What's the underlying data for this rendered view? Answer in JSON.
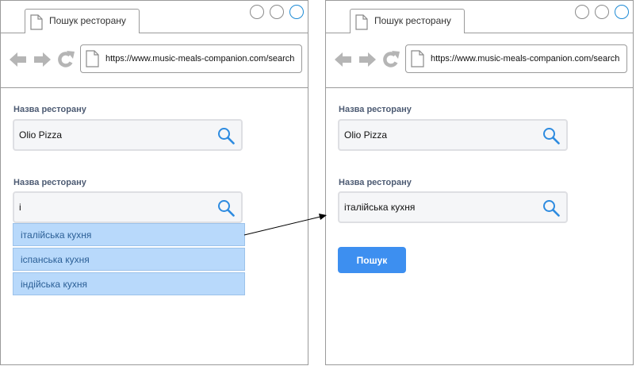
{
  "screens": {
    "left": {
      "tab_title": "Пошук ресторану",
      "url": "https://www.music-meals-companion.com/search",
      "field1": {
        "label": "Назва ресторану",
        "value": "Olio Pizza"
      },
      "field2": {
        "label": "Назва ресторану",
        "value": "і"
      },
      "suggestions": [
        "італійська кухня",
        "іспанська кухня",
        "індійська кухня"
      ]
    },
    "right": {
      "tab_title": "Пошук ресторану",
      "url": "https://www.music-meals-companion.com/search",
      "field1": {
        "label": "Назва ресторану",
        "value": "Olio Pizza"
      },
      "field2": {
        "label": "Назва ресторану",
        "value": "італійська кухня"
      },
      "search_button": "Пошук"
    }
  },
  "colors": {
    "accent": "#3d8ff0",
    "suggestion_bg": "#b8d9fb",
    "label": "#4d5b73"
  },
  "icons": [
    "page-icon",
    "back-arrow-icon",
    "forward-arrow-icon",
    "reload-icon",
    "search-icon"
  ]
}
